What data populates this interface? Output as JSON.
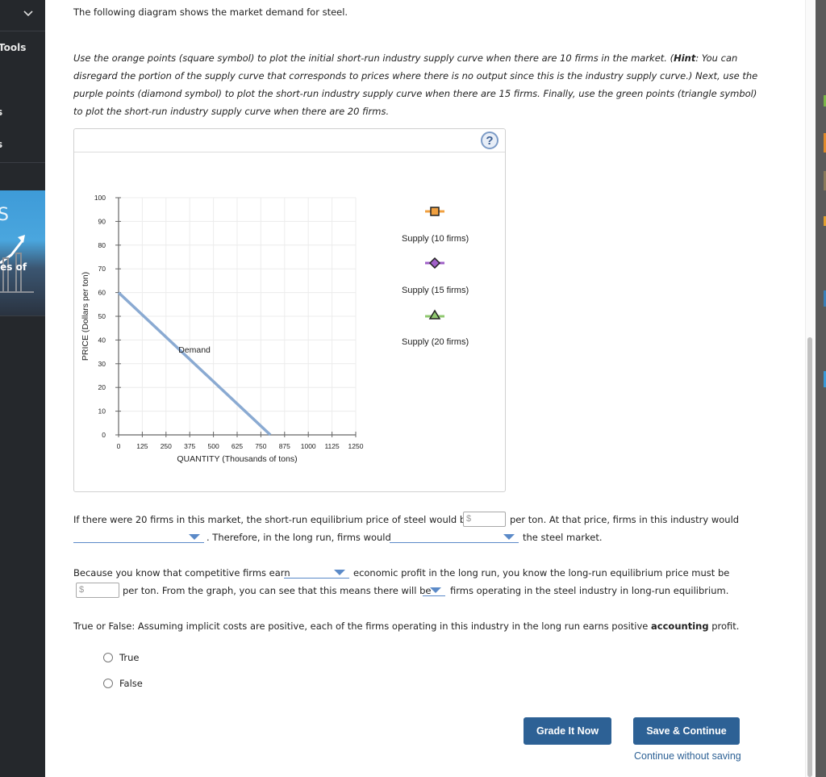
{
  "sidebar": {
    "items": [
      {
        "label": "Tools"
      },
      {
        "label": "s"
      },
      {
        "label": "s"
      }
    ],
    "banner": {
      "title": "S",
      "subtitle": "les of"
    }
  },
  "intro": "The following diagram shows the market demand for steel.",
  "instructions": {
    "part1": "Use the orange points (square symbol) to plot the initial short-run industry supply curve when there are 10 firms in the market. (",
    "hint_label": "Hint",
    "part2": ": You can disregard the portion of the supply curve that corresponds to prices where there is no output since this is the industry supply curve.) Next, use the purple points (diamond symbol) to plot the short-run industry supply curve when there are 15 firms. Finally, use the green points (triangle symbol) to plot the short-run industry supply curve when there are 20 firms."
  },
  "graph": {
    "help_label": "?",
    "legend": [
      {
        "label": "Supply (10 firms)",
        "symbol": "square",
        "color": "#f0a040"
      },
      {
        "label": "Supply (15 firms)",
        "symbol": "diamond",
        "color": "#a060c8"
      },
      {
        "label": "Supply (20 firms)",
        "symbol": "triangle",
        "color": "#90c870"
      }
    ]
  },
  "chart_data": {
    "type": "line",
    "title": "",
    "xlabel": "QUANTITY (Thousands of tons)",
    "ylabel": "PRICE (Dollars per ton)",
    "xlim": [
      0,
      1250
    ],
    "ylim": [
      0,
      100
    ],
    "x_ticks": [
      0,
      125,
      250,
      375,
      500,
      625,
      750,
      875,
      1000,
      1125,
      1250
    ],
    "y_ticks": [
      0,
      10,
      20,
      30,
      40,
      50,
      60,
      70,
      80,
      90,
      100
    ],
    "grid": true,
    "series": [
      {
        "name": "Demand",
        "color": "#8aaad2",
        "points": [
          [
            0,
            60
          ],
          [
            800,
            0
          ]
        ],
        "label_at": [
          375,
          35
        ]
      }
    ]
  },
  "questions": {
    "q1_text_a": "If there were 20 firms in this market, the short-run equilibrium price of steel would be",
    "q1_text_b": "per ton. At that price, firms in this industry would",
    "q1_text_c": ". Therefore, in the long run, firms would",
    "q1_text_d": "the steel market.",
    "q2_text_a": "Because you know that competitive firms earn",
    "q2_text_b": "economic profit in the long run, you know the long-run equilibrium price must be",
    "q2_text_c": "per ton. From the graph, you can see that this means there will be",
    "q2_text_d": "firms operating in the steel industry in long-run equilibrium.",
    "dollar_placeholder": "$",
    "q3_text_a": "True or False: Assuming implicit costs are positive, each of the firms operating in this industry in the long run earns positive ",
    "q3_bold": "accounting",
    "q3_text_b": " profit.",
    "options": [
      "True",
      "False"
    ]
  },
  "buttons": {
    "grade": "Grade It Now",
    "save": "Save & Continue",
    "continue_link": "Continue without saving"
  }
}
